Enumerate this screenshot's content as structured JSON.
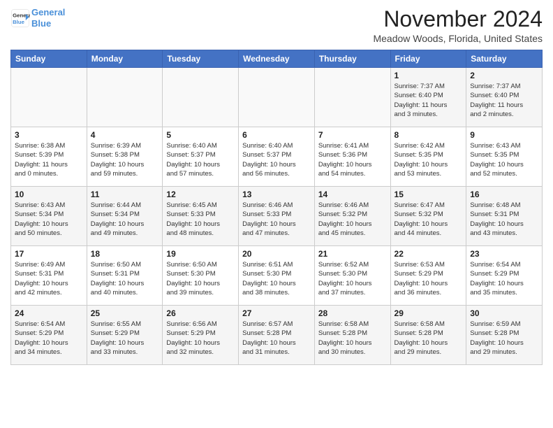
{
  "header": {
    "logo_line1": "General",
    "logo_line2": "Blue",
    "month_title": "November 2024",
    "location": "Meadow Woods, Florida, United States"
  },
  "weekdays": [
    "Sunday",
    "Monday",
    "Tuesday",
    "Wednesday",
    "Thursday",
    "Friday",
    "Saturday"
  ],
  "weeks": [
    [
      {
        "day": "",
        "info": ""
      },
      {
        "day": "",
        "info": ""
      },
      {
        "day": "",
        "info": ""
      },
      {
        "day": "",
        "info": ""
      },
      {
        "day": "",
        "info": ""
      },
      {
        "day": "1",
        "info": "Sunrise: 7:37 AM\nSunset: 6:40 PM\nDaylight: 11 hours\nand 3 minutes."
      },
      {
        "day": "2",
        "info": "Sunrise: 7:37 AM\nSunset: 6:40 PM\nDaylight: 11 hours\nand 2 minutes."
      }
    ],
    [
      {
        "day": "3",
        "info": "Sunrise: 6:38 AM\nSunset: 5:39 PM\nDaylight: 11 hours\nand 0 minutes."
      },
      {
        "day": "4",
        "info": "Sunrise: 6:39 AM\nSunset: 5:38 PM\nDaylight: 10 hours\nand 59 minutes."
      },
      {
        "day": "5",
        "info": "Sunrise: 6:40 AM\nSunset: 5:37 PM\nDaylight: 10 hours\nand 57 minutes."
      },
      {
        "day": "6",
        "info": "Sunrise: 6:40 AM\nSunset: 5:37 PM\nDaylight: 10 hours\nand 56 minutes."
      },
      {
        "day": "7",
        "info": "Sunrise: 6:41 AM\nSunset: 5:36 PM\nDaylight: 10 hours\nand 54 minutes."
      },
      {
        "day": "8",
        "info": "Sunrise: 6:42 AM\nSunset: 5:35 PM\nDaylight: 10 hours\nand 53 minutes."
      },
      {
        "day": "9",
        "info": "Sunrise: 6:43 AM\nSunset: 5:35 PM\nDaylight: 10 hours\nand 52 minutes."
      }
    ],
    [
      {
        "day": "10",
        "info": "Sunrise: 6:43 AM\nSunset: 5:34 PM\nDaylight: 10 hours\nand 50 minutes."
      },
      {
        "day": "11",
        "info": "Sunrise: 6:44 AM\nSunset: 5:34 PM\nDaylight: 10 hours\nand 49 minutes."
      },
      {
        "day": "12",
        "info": "Sunrise: 6:45 AM\nSunset: 5:33 PM\nDaylight: 10 hours\nand 48 minutes."
      },
      {
        "day": "13",
        "info": "Sunrise: 6:46 AM\nSunset: 5:33 PM\nDaylight: 10 hours\nand 47 minutes."
      },
      {
        "day": "14",
        "info": "Sunrise: 6:46 AM\nSunset: 5:32 PM\nDaylight: 10 hours\nand 45 minutes."
      },
      {
        "day": "15",
        "info": "Sunrise: 6:47 AM\nSunset: 5:32 PM\nDaylight: 10 hours\nand 44 minutes."
      },
      {
        "day": "16",
        "info": "Sunrise: 6:48 AM\nSunset: 5:31 PM\nDaylight: 10 hours\nand 43 minutes."
      }
    ],
    [
      {
        "day": "17",
        "info": "Sunrise: 6:49 AM\nSunset: 5:31 PM\nDaylight: 10 hours\nand 42 minutes."
      },
      {
        "day": "18",
        "info": "Sunrise: 6:50 AM\nSunset: 5:31 PM\nDaylight: 10 hours\nand 40 minutes."
      },
      {
        "day": "19",
        "info": "Sunrise: 6:50 AM\nSunset: 5:30 PM\nDaylight: 10 hours\nand 39 minutes."
      },
      {
        "day": "20",
        "info": "Sunrise: 6:51 AM\nSunset: 5:30 PM\nDaylight: 10 hours\nand 38 minutes."
      },
      {
        "day": "21",
        "info": "Sunrise: 6:52 AM\nSunset: 5:30 PM\nDaylight: 10 hours\nand 37 minutes."
      },
      {
        "day": "22",
        "info": "Sunrise: 6:53 AM\nSunset: 5:29 PM\nDaylight: 10 hours\nand 36 minutes."
      },
      {
        "day": "23",
        "info": "Sunrise: 6:54 AM\nSunset: 5:29 PM\nDaylight: 10 hours\nand 35 minutes."
      }
    ],
    [
      {
        "day": "24",
        "info": "Sunrise: 6:54 AM\nSunset: 5:29 PM\nDaylight: 10 hours\nand 34 minutes."
      },
      {
        "day": "25",
        "info": "Sunrise: 6:55 AM\nSunset: 5:29 PM\nDaylight: 10 hours\nand 33 minutes."
      },
      {
        "day": "26",
        "info": "Sunrise: 6:56 AM\nSunset: 5:29 PM\nDaylight: 10 hours\nand 32 minutes."
      },
      {
        "day": "27",
        "info": "Sunrise: 6:57 AM\nSunset: 5:28 PM\nDaylight: 10 hours\nand 31 minutes."
      },
      {
        "day": "28",
        "info": "Sunrise: 6:58 AM\nSunset: 5:28 PM\nDaylight: 10 hours\nand 30 minutes."
      },
      {
        "day": "29",
        "info": "Sunrise: 6:58 AM\nSunset: 5:28 PM\nDaylight: 10 hours\nand 29 minutes."
      },
      {
        "day": "30",
        "info": "Sunrise: 6:59 AM\nSunset: 5:28 PM\nDaylight: 10 hours\nand 29 minutes."
      }
    ]
  ]
}
